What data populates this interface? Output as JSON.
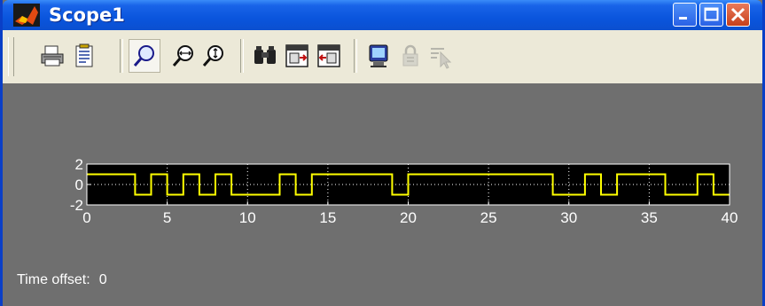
{
  "window": {
    "title": "Scope1",
    "icon": "matlab-logo-icon",
    "controls": [
      "minimize",
      "maximize",
      "close"
    ]
  },
  "toolbar": {
    "buttons": [
      {
        "name": "print",
        "icon": "print-icon"
      },
      {
        "name": "parameters",
        "icon": "parameters-icon"
      },
      {
        "name": "zoom",
        "icon": "zoom-icon",
        "pressed": true
      },
      {
        "name": "zoom-x-axis",
        "icon": "zoom-x-icon"
      },
      {
        "name": "zoom-y-axis",
        "icon": "zoom-y-icon"
      },
      {
        "name": "autoscale",
        "icon": "binoculars-icon"
      },
      {
        "name": "save-axes-settings",
        "icon": "save-axes-icon"
      },
      {
        "name": "restore-axes-settings",
        "icon": "restore-axes-icon"
      },
      {
        "name": "floating-scope",
        "icon": "floating-scope-icon"
      },
      {
        "name": "lock-axes",
        "icon": "lock-icon",
        "disabled": true
      },
      {
        "name": "signal-selector",
        "icon": "signal-selector-icon",
        "disabled": true
      }
    ]
  },
  "status": {
    "label": "Time offset:",
    "value": "0"
  },
  "colors": {
    "figure_bg": "#6f6f6f",
    "axes_bg": "#000000",
    "trace": "#ffff00",
    "grid": "#ffffff",
    "titlebar": "#0a55dd"
  },
  "chart_data": {
    "type": "line",
    "title": "",
    "xlabel": "",
    "ylabel": "",
    "xlim": [
      0,
      40
    ],
    "ylim": [
      -2,
      2
    ],
    "xticks": [
      0,
      5,
      10,
      15,
      20,
      25,
      30,
      35,
      40
    ],
    "yticks": [
      2,
      0,
      -2
    ],
    "grid": true,
    "series": [
      {
        "x": [
          0,
          3,
          3,
          4,
          4,
          5,
          5,
          6,
          6,
          7,
          7,
          8,
          8,
          9,
          9,
          12,
          12,
          13,
          13,
          14,
          14,
          19,
          19,
          20,
          20,
          29,
          29,
          31,
          31,
          32,
          32,
          33,
          33,
          36,
          36,
          38,
          38,
          39,
          39,
          40
        ],
        "y": [
          1,
          1,
          -1,
          -1,
          1,
          1,
          -1,
          -1,
          1,
          1,
          -1,
          -1,
          1,
          1,
          -1,
          -1,
          1,
          1,
          -1,
          -1,
          1,
          1,
          -1,
          -1,
          1,
          1,
          -1,
          -1,
          1,
          1,
          -1,
          -1,
          1,
          1,
          -1,
          -1,
          1,
          1,
          -1,
          -1
        ]
      }
    ]
  }
}
